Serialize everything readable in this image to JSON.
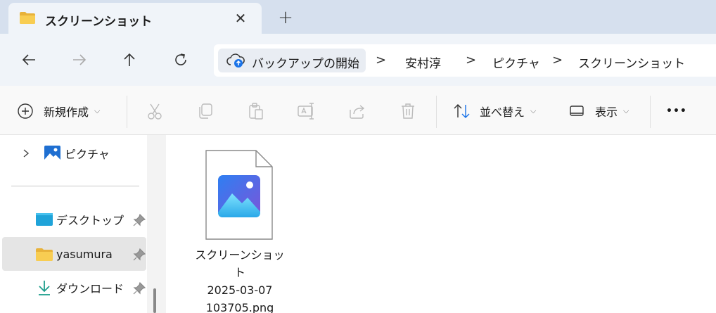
{
  "tab": {
    "title": "スクリーンショット",
    "close_symbol": "✕",
    "new_tab_symbol": "+"
  },
  "nav": {
    "back_symbol": "←",
    "forward_symbol": "→",
    "up_symbol": "↑",
    "refresh_symbol": "↻"
  },
  "address": {
    "root_label": "バックアップの開始",
    "separator": ">",
    "crumbs": [
      "安村淳",
      "ピクチャ",
      "スクリーンショット"
    ]
  },
  "toolbar": {
    "new_label": "新規作成",
    "sort_label": "並べ替え",
    "view_label": "表示",
    "more_symbol": "•••",
    "chevron": "⌵"
  },
  "sidebar": {
    "items": [
      {
        "label": "ピクチャ",
        "icon": "pictures-icon"
      },
      {
        "label": "デスクトップ",
        "icon": "desktop-icon",
        "pinned": true
      },
      {
        "label": "yasumura",
        "icon": "folder-icon",
        "pinned": true,
        "selected": true
      },
      {
        "label": "ダウンロード",
        "icon": "download-icon",
        "pinned": true
      }
    ]
  },
  "files": [
    {
      "name_line1": "スクリーンショット",
      "name_line2": "2025-03-07",
      "name_line3": "103705.png",
      "icon": "image-file-icon"
    }
  ],
  "colors": {
    "accent": "#1a73e8",
    "tabstrip": "#d6e0ee",
    "selected": "#e5e5e5",
    "folder": "#f5c542"
  }
}
